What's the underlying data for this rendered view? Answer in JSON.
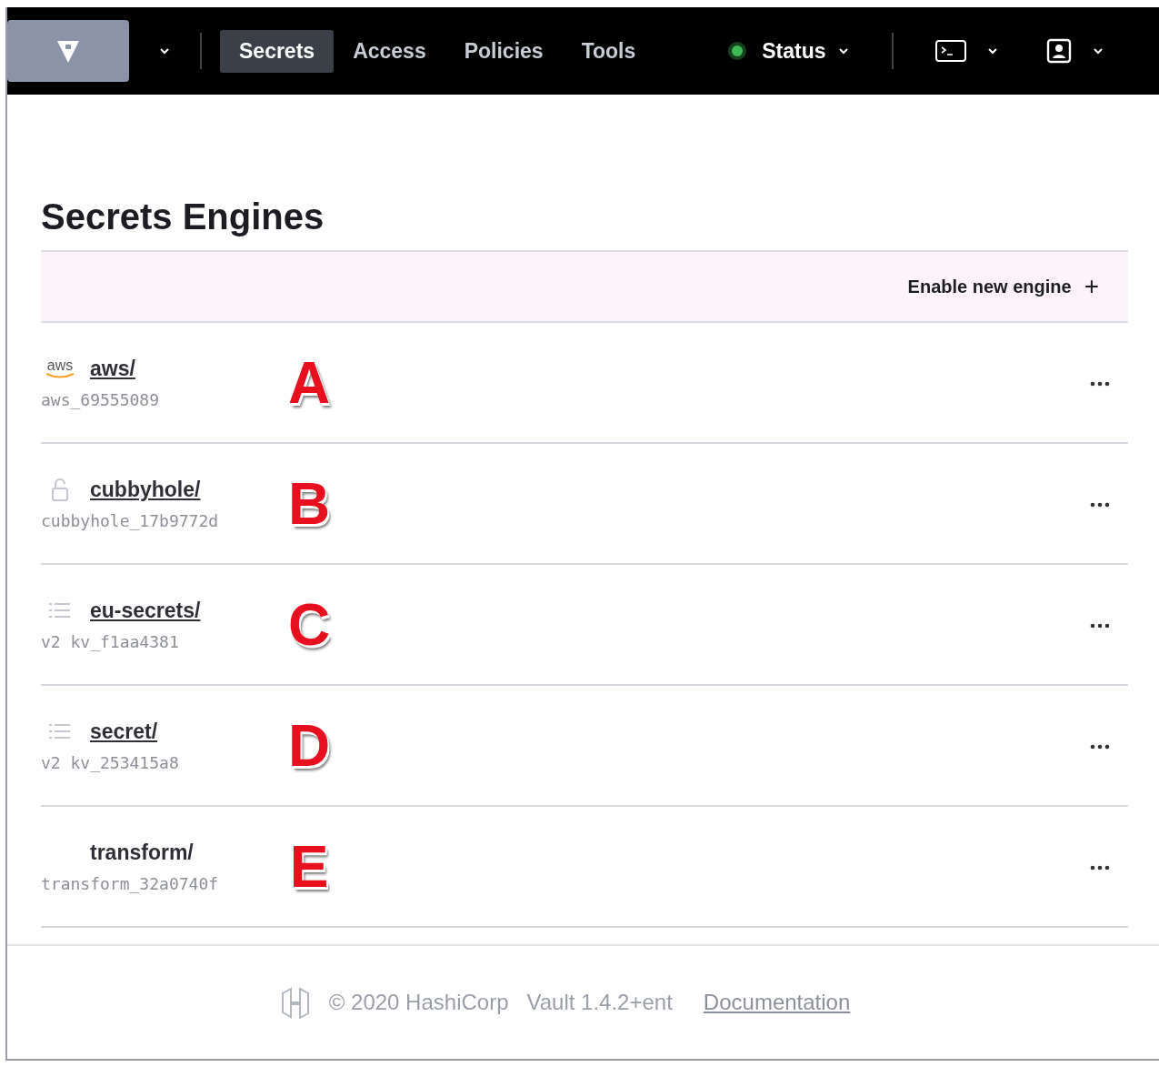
{
  "nav": {
    "items": [
      {
        "label": "Secrets",
        "selected": true
      },
      {
        "label": "Access",
        "selected": false
      },
      {
        "label": "Policies",
        "selected": false
      },
      {
        "label": "Tools",
        "selected": false
      }
    ],
    "status": {
      "label": "Status",
      "color": "#3fb950"
    }
  },
  "page": {
    "title": "Secrets Engines",
    "action": "Enable new engine",
    "action_icon": "+"
  },
  "engines": [
    {
      "kind": "aws",
      "logo_text": "aws",
      "path": "aws/",
      "link": true,
      "accessor": "aws_69555089",
      "marker": "A"
    },
    {
      "kind": "lock",
      "path": "cubbyhole/",
      "link": true,
      "accessor": "cubbyhole_17b9772d",
      "marker": "B"
    },
    {
      "kind": "list",
      "path": "eu-secrets/",
      "link": true,
      "accessor": "v2 kv_f1aa4381",
      "marker": "C"
    },
    {
      "kind": "list",
      "path": "secret/",
      "link": true,
      "accessor": "v2 kv_253415a8",
      "marker": "D"
    },
    {
      "kind": "none",
      "path": "transform/",
      "link": false,
      "accessor": "transform_32a0740f",
      "marker": "E"
    }
  ],
  "footer": {
    "copyright": "© 2020 HashiCorp",
    "version": "Vault 1.4.2+ent",
    "link": "Documentation"
  }
}
